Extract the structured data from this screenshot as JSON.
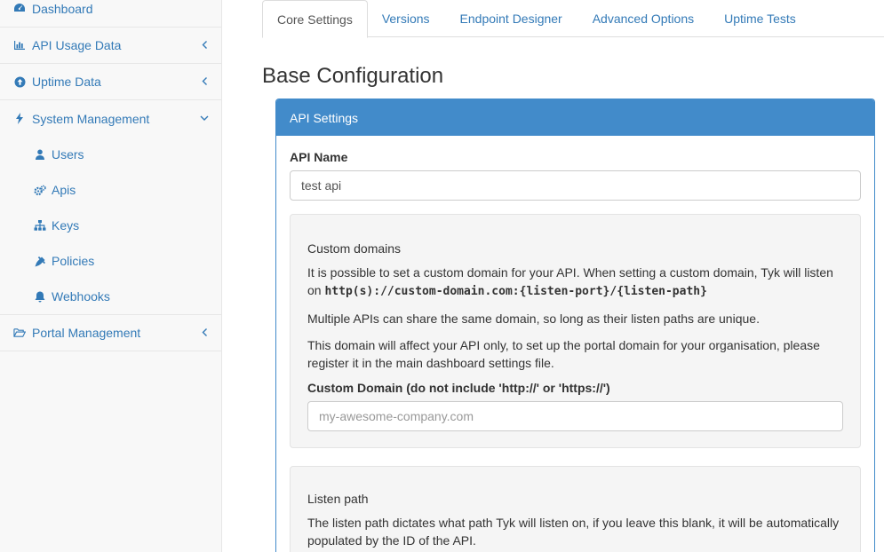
{
  "sidebar": {
    "items": [
      {
        "label": "Dashboard",
        "icon": "dashboard-icon"
      },
      {
        "label": "API Usage Data",
        "icon": "bar-chart-icon"
      },
      {
        "label": "Uptime Data",
        "icon": "arrow-circle-up-icon"
      },
      {
        "label": "System Management",
        "icon": "bolt-icon"
      },
      {
        "label": "Portal Management",
        "icon": "folder-open-icon"
      }
    ],
    "sub_items": [
      {
        "label": "Users",
        "icon": "user-icon"
      },
      {
        "label": "Apis",
        "icon": "cogs-icon"
      },
      {
        "label": "Keys",
        "icon": "sitemap-icon"
      },
      {
        "label": "Policies",
        "icon": "plug-icon"
      },
      {
        "label": "Webhooks",
        "icon": "bell-icon"
      }
    ]
  },
  "tabs": [
    "Core Settings",
    "Versions",
    "Endpoint Designer",
    "Advanced Options",
    "Uptime Tests"
  ],
  "page_title": "Base Configuration",
  "panel": {
    "heading": "API Settings",
    "api_name_label": "API Name",
    "api_name_value": "test api",
    "custom_domains": {
      "title": "Custom domains",
      "p1_text": "It is possible to set a custom domain for your API. When setting a custom domain, Tyk will listen on ",
      "p1_code": "http(s)://custom-domain.com:{listen-port}/{listen-path}",
      "p2": "Multiple APIs can share the same domain, so long as their listen paths are unique.",
      "p3": "This domain will affect your API only, to set up the portal domain for your organisation, please register it in the main dashboard settings file.",
      "field_label": "Custom Domain (do not include 'http://' or 'https://')",
      "field_placeholder": "my-awesome-company.com"
    },
    "listen_path": {
      "title": "Listen path",
      "p1": "The listen path dictates what path Tyk will listen on, if you leave this blank, it will be automatically populated by the ID of the API."
    }
  },
  "colors": {
    "link": "#337ab7",
    "panel_primary": "#428bca"
  }
}
